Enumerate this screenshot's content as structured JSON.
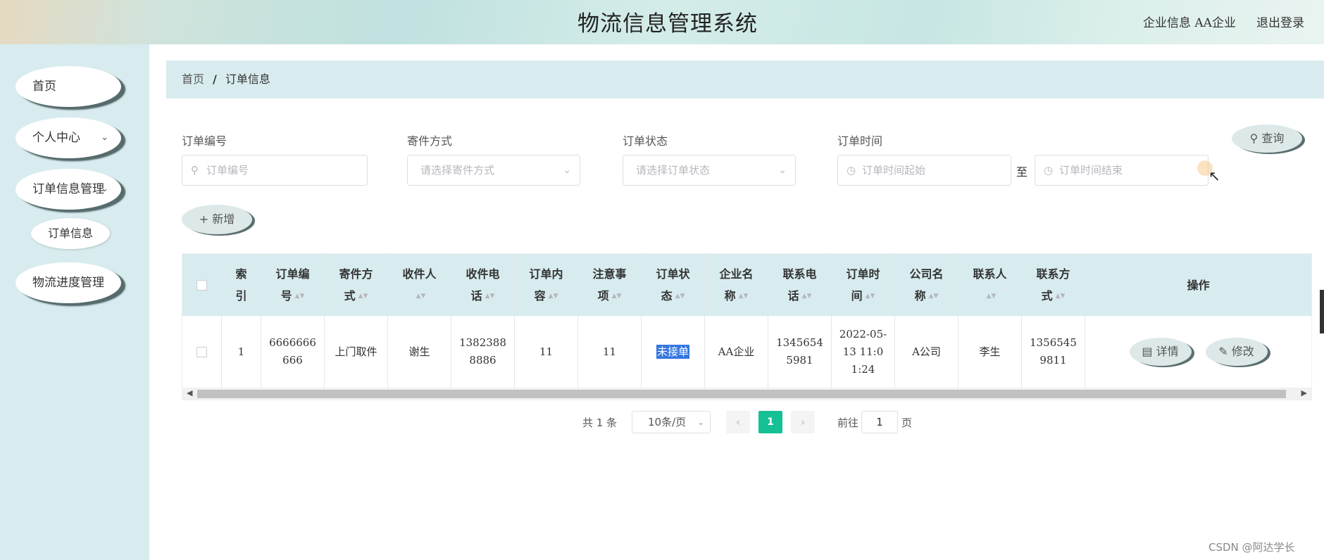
{
  "header": {
    "title": "物流信息管理系统",
    "enterprise_label": "企业信息 AA企业",
    "logout_label": "退出登录"
  },
  "sidebar": {
    "items": [
      {
        "label": "首页"
      },
      {
        "label": "个人中心",
        "chevron": "⌄"
      },
      {
        "label": "订单信息管理",
        "chevron": "⌄"
      },
      {
        "label": "订单信息"
      },
      {
        "label": "物流进度管理"
      }
    ]
  },
  "breadcrumb": {
    "home": "首页",
    "separator": "/",
    "current": "订单信息"
  },
  "search": {
    "order_no_label": "订单编号",
    "order_no_placeholder": "订单编号",
    "ship_method_label": "寄件方式",
    "ship_method_placeholder": "请选择寄件方式",
    "order_status_label": "订单状态",
    "order_status_placeholder": "请选择订单状态",
    "order_time_label": "订单时间",
    "time_start_placeholder": "订单时间起始",
    "time_to": "至",
    "time_end_placeholder": "订单时间结束",
    "query_button": "查询",
    "add_button": "新增"
  },
  "table": {
    "headers": [
      "索引",
      "订单编号",
      "寄件方式",
      "收件人",
      "收件电话",
      "订单内容",
      "注意事项",
      "订单状态",
      "企业名称",
      "联系电话",
      "订单时间",
      "公司名称",
      "联系人",
      "联系方式",
      "操作"
    ],
    "rows": [
      [
        "1",
        "6666666666",
        "上门取件",
        "谢生",
        "13823888886",
        "11",
        "11",
        "未接单",
        "AA企业",
        "13456545981",
        "2022-05-13 11:01:24",
        "A公司",
        "李生",
        "13565459811"
      ]
    ],
    "detail_button": "详情",
    "edit_button": "修改"
  },
  "pagination": {
    "total_prefix": "共",
    "total": "1",
    "total_suffix": "条",
    "page_size": "10条/页",
    "current_page": "1",
    "goto_prefix": "前往",
    "goto_value": "1",
    "goto_suffix": "页"
  },
  "watermark": "CSDN @阿达学长",
  "colors": {
    "accent": "#16c095",
    "panel": "#d8ecef",
    "highlight": "#3677e0"
  }
}
